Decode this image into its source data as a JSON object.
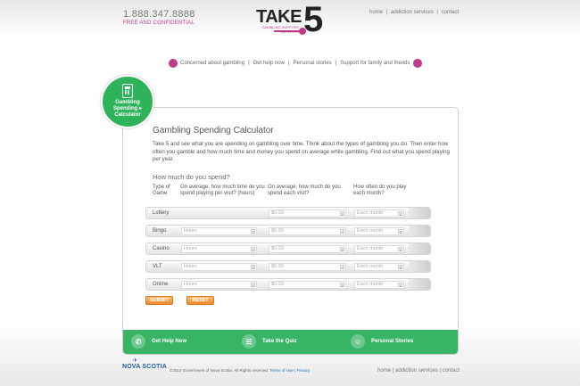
{
  "header": {
    "phone": "1.888.347.8888",
    "phone_sub": "FREE AND CONFIDENTIAL",
    "logo_word": "TAKE",
    "logo_number": "5",
    "logo_sub1": "GAMBLING SUPPORT",
    "logo_sub2": "NETWORK",
    "links": [
      "home",
      "addiction services",
      "contact"
    ]
  },
  "subnav": {
    "items": [
      "Concerned about gambling",
      "Get help now",
      "Personal stories",
      "Support for family and friends"
    ]
  },
  "badge": {
    "line1": "Gambling",
    "line2": "Spending ▸",
    "line3": "Calculator"
  },
  "calculator": {
    "title": "Gambling Spending Calculator",
    "intro": "Take 5 and see what you are spending on gambling over time. Think about the types of gambling you do. Then enter how often you gamble and how much time and money you spend on average while gambling. Find out what you spend playing per year.",
    "subheading": "How much do you spend?",
    "columns": [
      "Type of Game",
      "On average, how much time do you spend playing per visit? (hours)",
      "On average, how much do you spend each visit?",
      "How often do you play each month?"
    ],
    "rows": [
      {
        "label": "Lottery",
        "hours_placeholder": "",
        "spend_placeholder": "$0.00",
        "month_placeholder": "Each month"
      },
      {
        "label": "Bingo",
        "hours_placeholder": "Hours",
        "spend_placeholder": "$0.00",
        "month_placeholder": "Each month"
      },
      {
        "label": "Casino",
        "hours_placeholder": "Hours",
        "spend_placeholder": "$0.00",
        "month_placeholder": "Each month"
      },
      {
        "label": "VLT",
        "hours_placeholder": "Hours",
        "spend_placeholder": "$0.00",
        "month_placeholder": "Each month"
      },
      {
        "label": "Online",
        "hours_placeholder": "Hours",
        "spend_placeholder": "$0.00",
        "month_placeholder": "Each month"
      }
    ],
    "submit_label": "SUBMIT",
    "reset_label": "RESET"
  },
  "footer_bar": {
    "items": [
      "Get Help Now",
      "Take the Quiz",
      "Personal Stories"
    ]
  },
  "footer": {
    "brand": "NOVA SCOTIA",
    "copyright": "©2014 Government of Nova Scotia. All Rights reserved.",
    "terms": "Terms of Use",
    "privacy": "Privacy",
    "links": [
      "home",
      "addiction services",
      "contact"
    ]
  },
  "colors": {
    "accent_pink": "#c0398b",
    "accent_green": "#37b465",
    "button_orange": "#ee8a25"
  }
}
